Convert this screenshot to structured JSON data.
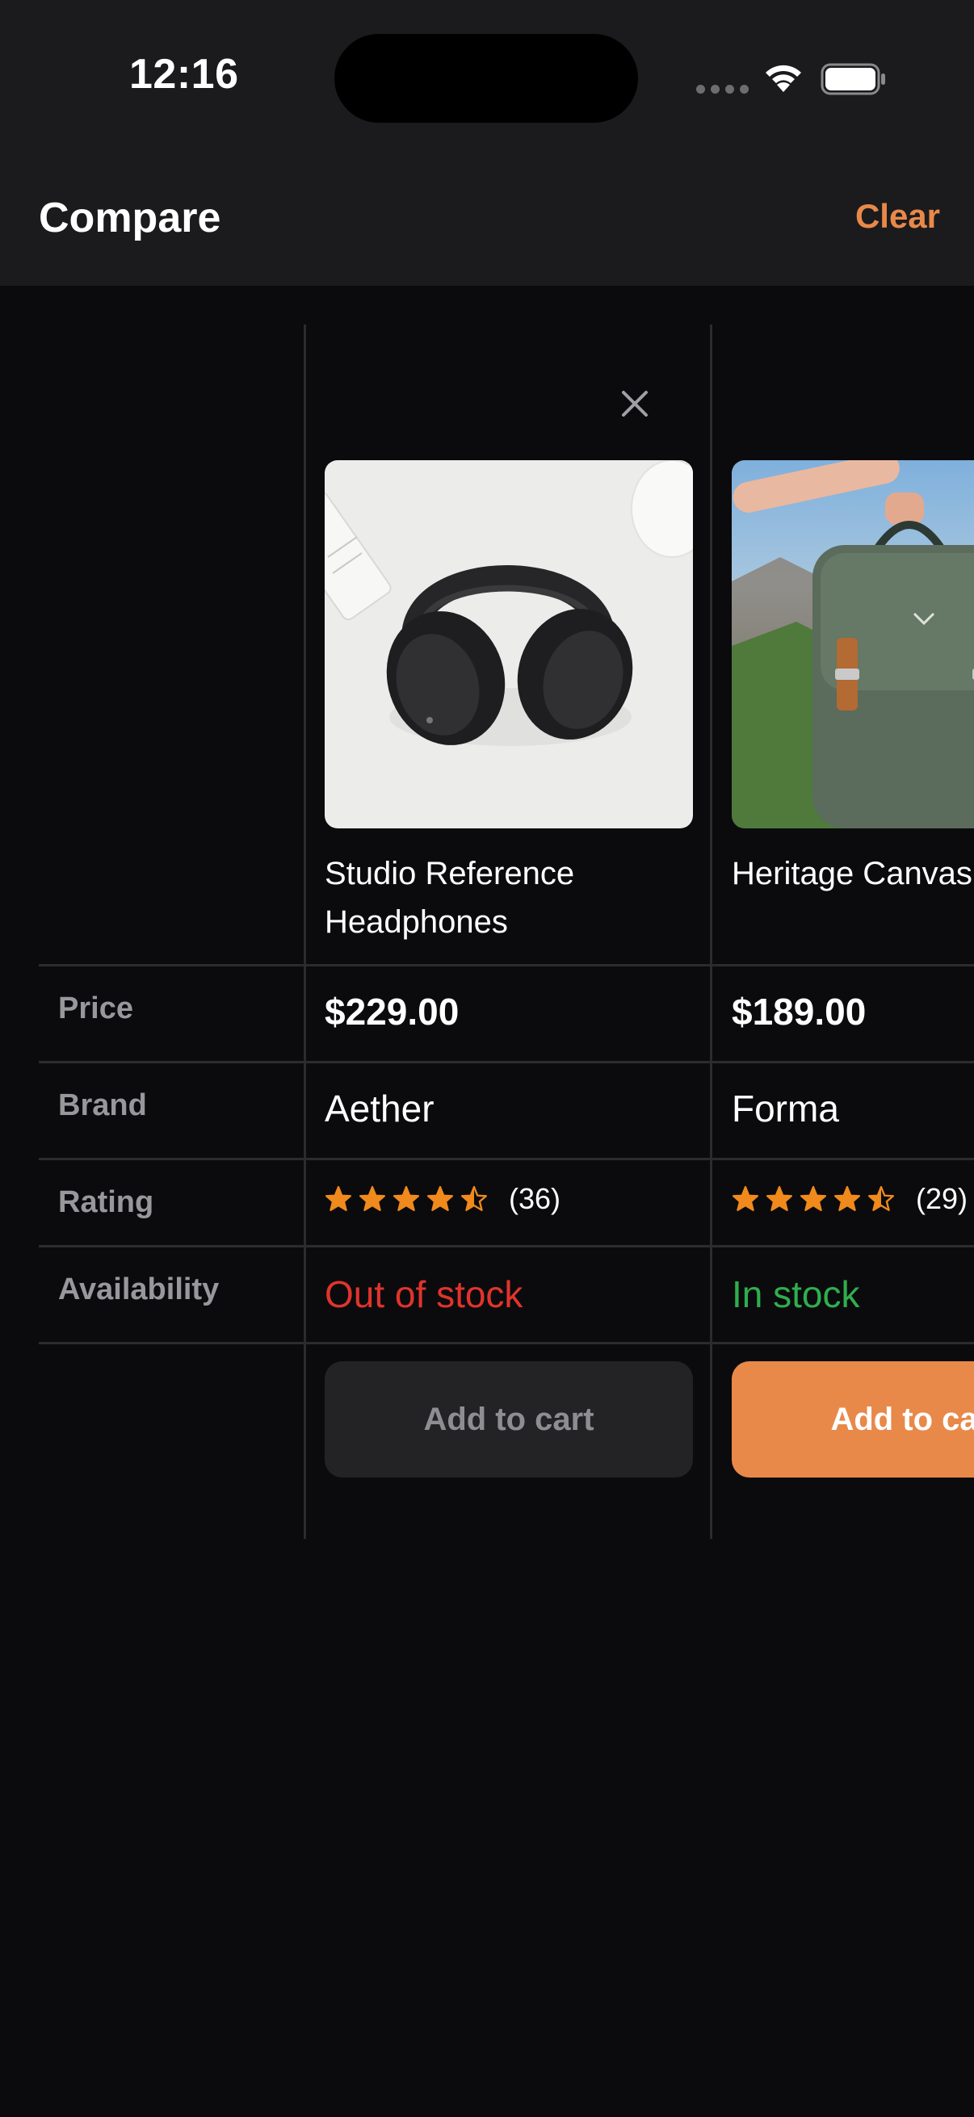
{
  "status_bar": {
    "time": "12:16"
  },
  "nav": {
    "title": "Compare",
    "clear_label": "Clear"
  },
  "row_labels": {
    "price": "Price",
    "brand": "Brand",
    "rating": "Rating",
    "availability": "Availability"
  },
  "products": [
    {
      "name_line1": "Studio Reference",
      "name_line2": "Headphones",
      "price": "$229.00",
      "brand": "Aether",
      "rating": 4.5,
      "rating_count": "(36)",
      "availability": "Out of stock",
      "availability_color": "#e0342c",
      "cart_label": "Add to cart",
      "cart_enabled": false
    },
    {
      "name_line1": "Heritage Canvas Backpack",
      "name_line2": "",
      "price": "$189.00",
      "brand": "Forma",
      "rating": 4.5,
      "rating_count": "(29)",
      "availability": "In stock",
      "availability_color": "#2fae4e",
      "cart_label": "Add to cart",
      "cart_enabled": true
    }
  ],
  "colors": {
    "accent": "#e8894a",
    "star": "#f08a1c",
    "background": "#0b0b0d",
    "bar": "#1b1b1d"
  }
}
